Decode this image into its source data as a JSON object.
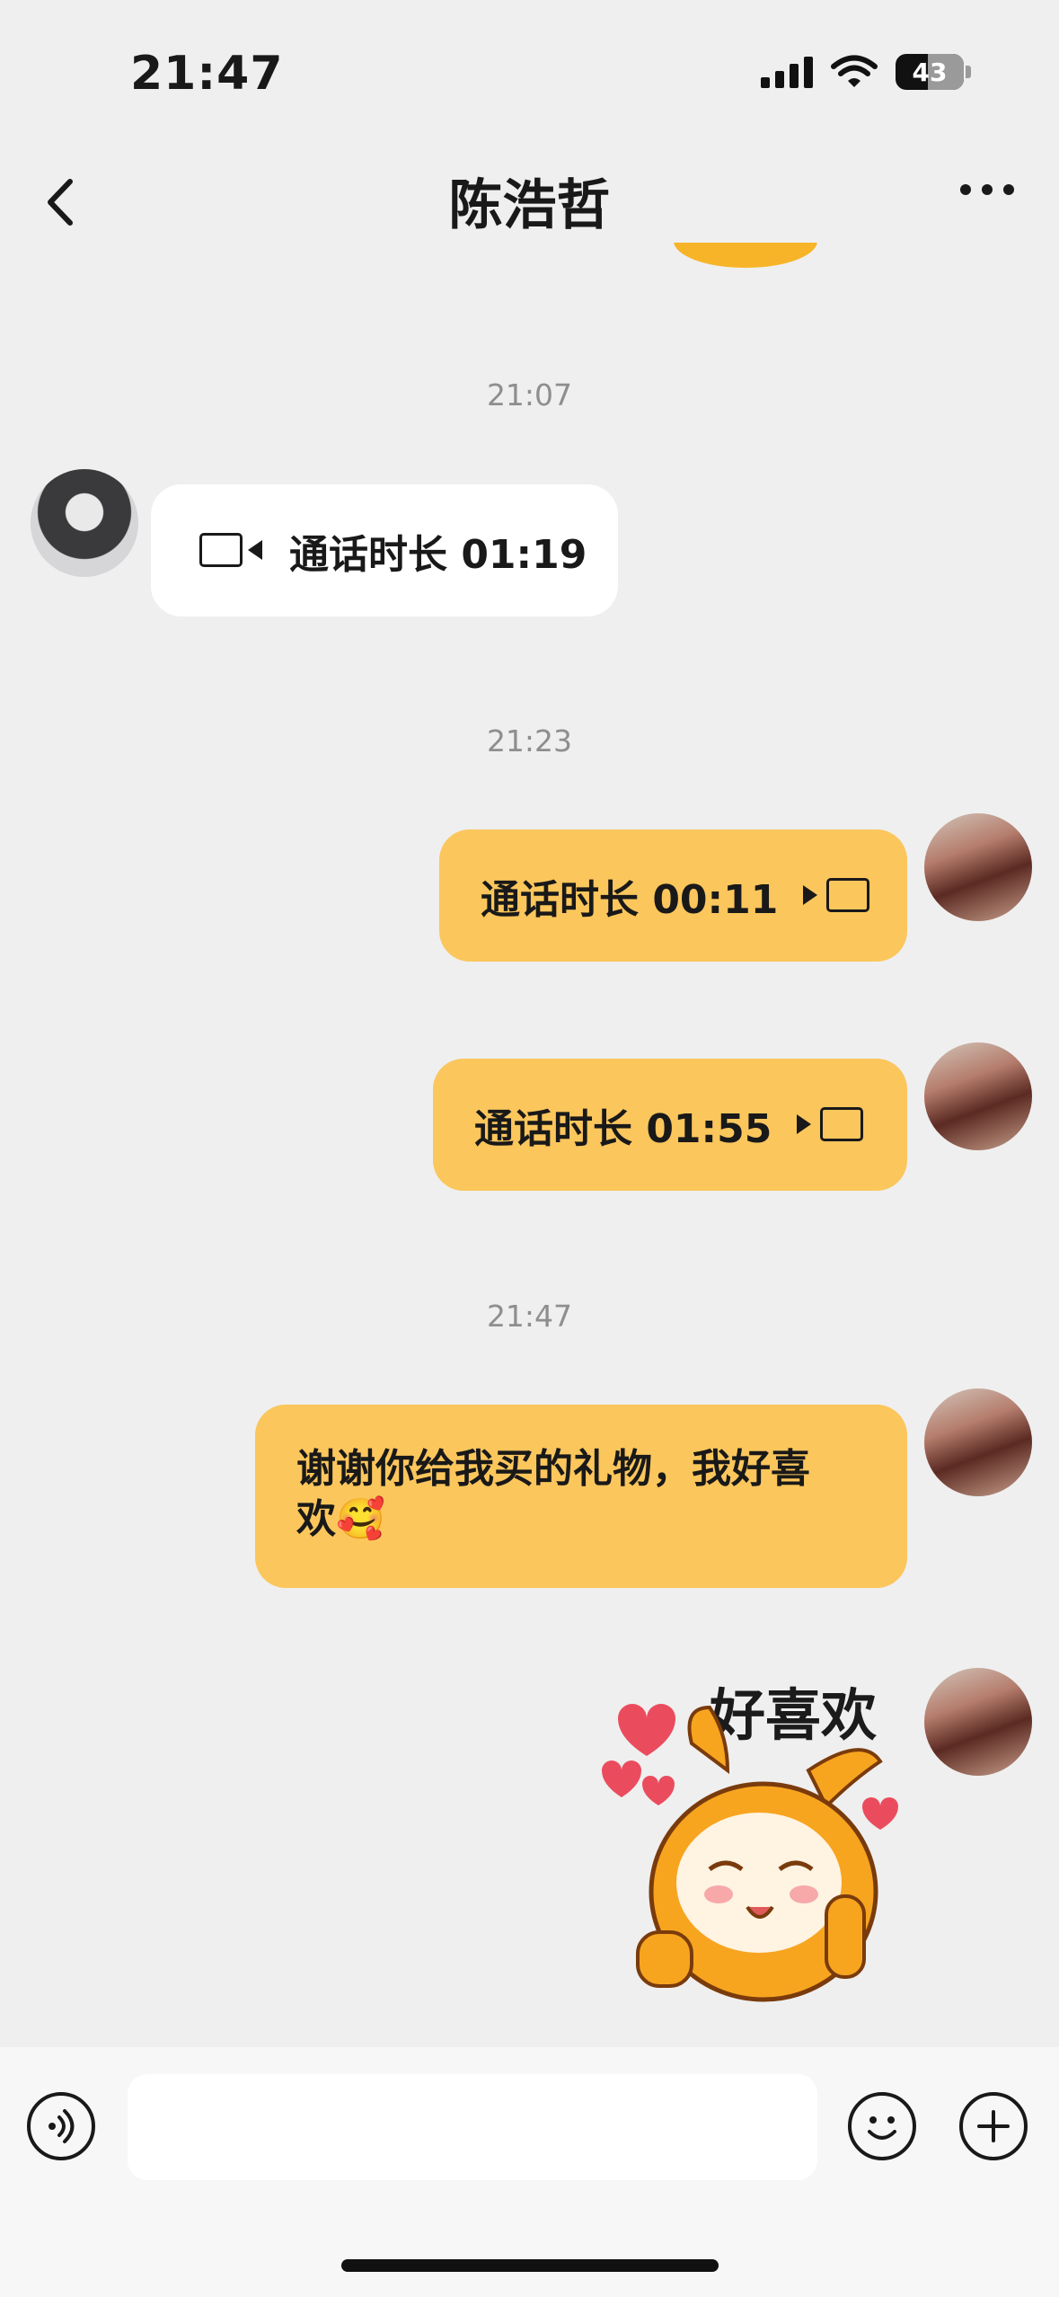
{
  "status_bar": {
    "time": "21:47",
    "battery_level": "43",
    "icons": [
      "cellular-signal-icon",
      "wifi-icon",
      "battery-icon"
    ]
  },
  "header": {
    "title": "陈浩哲",
    "back_icon": "chevron-left-icon",
    "more_icon": "ellipsis-icon"
  },
  "messages": [
    {
      "type": "timestamp",
      "text": "21:07"
    },
    {
      "type": "video_call",
      "side": "left",
      "text": "通话时长 01:19",
      "icon": "video-camera-icon"
    },
    {
      "type": "timestamp",
      "text": "21:23"
    },
    {
      "type": "video_call",
      "side": "right",
      "text": "通话时长 00:11",
      "icon": "video-camera-icon"
    },
    {
      "type": "video_call",
      "side": "right",
      "text": "通话时长 01:55",
      "icon": "video-camera-icon"
    },
    {
      "type": "timestamp",
      "text": "21:47"
    },
    {
      "type": "text",
      "side": "right",
      "line1": "谢谢你给我买的礼物，我好喜",
      "line2": "欢🥰"
    },
    {
      "type": "sticker",
      "side": "right",
      "caption": "好喜欢"
    }
  ],
  "input_bar": {
    "placeholder": "",
    "voice_icon": "voice-icon",
    "emoji_icon": "emoji-icon",
    "plus_icon": "plus-icon"
  },
  "colors": {
    "background": "#efefef",
    "outgoing_bubble": "#fbc65c",
    "incoming_bubble": "#ffffff",
    "timestamp_text": "#8e8e8e"
  }
}
